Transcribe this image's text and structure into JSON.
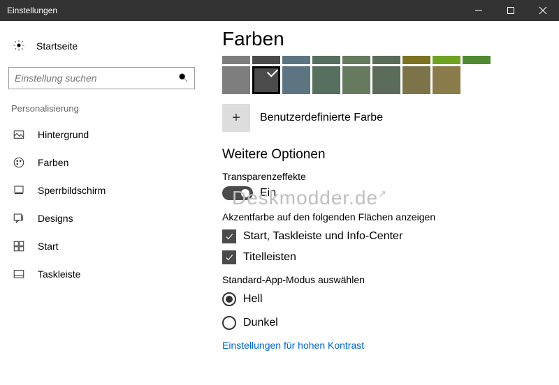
{
  "window": {
    "title": "Einstellungen"
  },
  "sidebar": {
    "home": "Startseite",
    "search_placeholder": "Einstellung suchen",
    "section": "Personalisierung",
    "items": [
      {
        "label": "Hintergrund"
      },
      {
        "label": "Farben"
      },
      {
        "label": "Sperrbildschirm"
      },
      {
        "label": "Designs"
      },
      {
        "label": "Start"
      },
      {
        "label": "Taskleiste"
      }
    ]
  },
  "page": {
    "title": "Farben",
    "swatch_thin": [
      "#7e7e7e",
      "#4b4b4b",
      "#5d7581",
      "#576f5f",
      "#657a5f",
      "#5a6b5a",
      "#7c7322",
      "#6fa421",
      "#4f8a32"
    ],
    "swatch_big": [
      "#7e7e7e",
      "#4b4b4b",
      "#5d7581",
      "#576f5f",
      "#657a5f",
      "#5a6b5a",
      "#7c7349",
      "#8a7b4a"
    ],
    "swatch_selected_index": 1,
    "custom_color_label": "Benutzerdefinierte Farbe",
    "more_options": "Weitere Optionen",
    "transparency_label": "Transparenzeffekte",
    "transparency_state": "Ein",
    "transparency_on": true,
    "accent_group": "Akzentfarbe auf den folgenden Flächen anzeigen",
    "accent_checks": [
      {
        "label": "Start, Taskleiste und Info-Center",
        "checked": true
      },
      {
        "label": "Titelleisten",
        "checked": true
      }
    ],
    "app_mode_group": "Standard-App-Modus auswählen",
    "app_modes": [
      {
        "label": "Hell",
        "selected": true
      },
      {
        "label": "Dunkel",
        "selected": false
      }
    ],
    "high_contrast_link": "Einstellungen für hohen Kontrast"
  },
  "watermark": "Deskmodder.de"
}
